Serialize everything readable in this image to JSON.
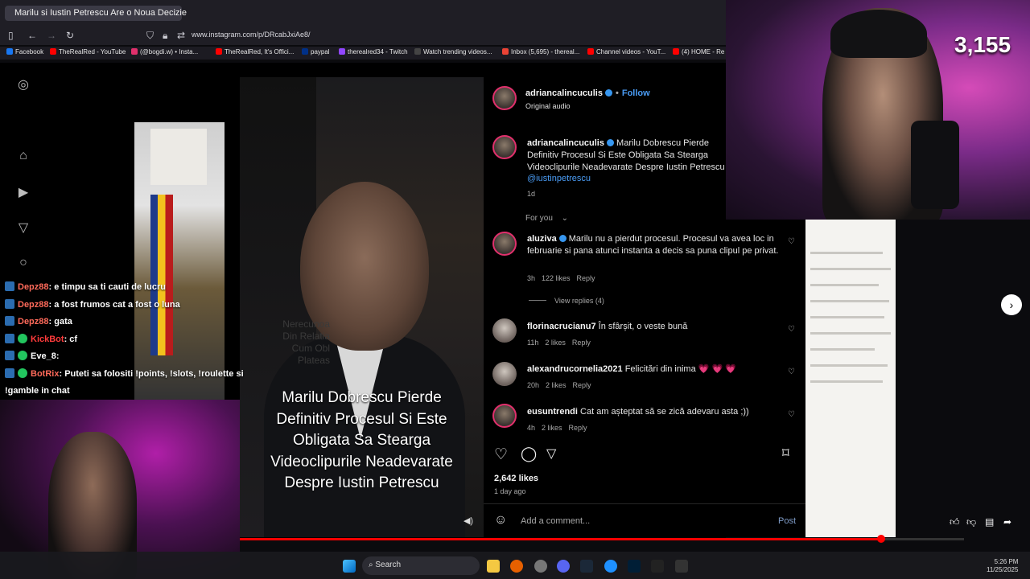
{
  "browser": {
    "tab_title": "Marilu si Iustin Petrescu Are o Noua Decizie",
    "url": "www.instagram.com/p/DRcabJxiAe8/",
    "bookmarks": [
      {
        "label": "Facebook",
        "color": "#1877f2"
      },
      {
        "label": "TheRealRed - YouTube",
        "color": "#ff0000"
      },
      {
        "label": "(@bogdi.w) • Insta...",
        "color": "#e1306c"
      },
      {
        "label": "TheRealRed, It's Offici...",
        "color": "#ff0000"
      },
      {
        "label": "paypal",
        "color": "#003087"
      },
      {
        "label": "therealred34 - Twitch",
        "color": "#9146ff"
      },
      {
        "label": "Watch trending videos...",
        "color": "#444444"
      },
      {
        "label": "Inbox (5,695) - thereal...",
        "color": "#ea4335"
      },
      {
        "label": "Channel videos - YouT...",
        "color": "#ff0000"
      },
      {
        "label": "(4) HOME - Re",
        "color": "#ff0000"
      }
    ]
  },
  "video": {
    "caption_lines": [
      "Marilu Dobrescu Pierde",
      "Definitiv Procesul Si Este",
      "Obligata Sa Stearga",
      "Videoclipurile Neadevarate",
      "Despre Iustin Petrescu"
    ],
    "side_text_lines": [
      "Nerecunoa",
      "Din Relatia",
      "Cum Obl",
      "Plateas"
    ]
  },
  "post": {
    "author": "adriancalincuculis",
    "follow_label": "Follow",
    "audio": "Original audio",
    "caption": "Marilu Dobrescu Pierde Definitiv Procesul Si Este Obligata Sa Stearga Videoclipurile Neadevarate Despre Iustin Petrescu",
    "mention": "@iustinpetrescu",
    "age": "1d",
    "sort_label": "For you",
    "likes": "2,642 likes",
    "posted": "1 day ago",
    "comment_placeholder": "Add a comment...",
    "post_label": "Post"
  },
  "comments": [
    {
      "user": "aluziva",
      "verified": true,
      "text": "Marilu nu a pierdut procesul. Procesul va avea loc in februarie si pana atunci instanta a decis sa puna clipul pe privat.",
      "time": "3h",
      "likes": "122 likes",
      "reply": "Reply",
      "view_replies": "View replies (4)"
    },
    {
      "user": "florinacrucianu7",
      "verified": false,
      "text": "În sfârșit, o veste bună",
      "time": "11h",
      "likes": "2 likes",
      "reply": "Reply"
    },
    {
      "user": "alexandrucornelia2021",
      "verified": false,
      "text": "Felicitări din inima 💗 💗 💗",
      "time": "20h",
      "likes": "2 likes",
      "reply": "Reply"
    },
    {
      "user": "eusuntrendi",
      "verified": false,
      "text": "Cat am așteptat să se zică adevaru asta ;))",
      "time": "4h",
      "likes": "2 likes",
      "reply": "Reply"
    }
  ],
  "stream": {
    "viewer_count": "3,155"
  },
  "chat": [
    {
      "name": "Depz88",
      "message": "e timpu sa ti cauti de lucru",
      "name_color": "#ff6a5a"
    },
    {
      "name": "Depz88",
      "message": "a fost frumos cat a fost o luna",
      "name_color": "#ff6a5a"
    },
    {
      "name": "Depz88",
      "message": "gata",
      "name_color": "#ff6a5a"
    },
    {
      "name": "KickBot",
      "message": "cf",
      "name_color": "#ff3b3b"
    },
    {
      "name": "Eve_8",
      "message": "",
      "name_color": "#ffffff"
    },
    {
      "name": "BotRix",
      "message": "Puteti sa folositi !points, !slots, !roulette si",
      "name_color": "#ff6a5a"
    },
    {
      "name": "",
      "message": "!gamble in chat",
      "name_color": "#ffffff"
    }
  ],
  "taskbar": {
    "search_label": "Search",
    "time": "5:26 PM",
    "date": "11/25/2025"
  },
  "player": {
    "progress": 0.885
  }
}
